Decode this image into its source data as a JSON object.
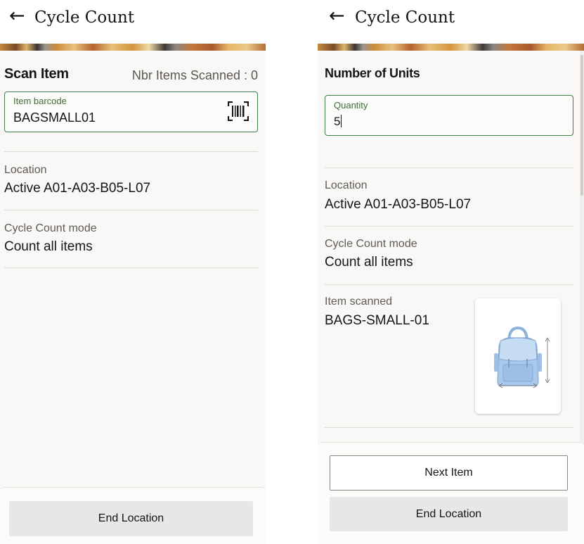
{
  "left_screen": {
    "app_bar": {
      "back_icon": "←",
      "title": "Cycle Count"
    },
    "scan_section": {
      "title": "Scan Item",
      "items_scanned_label": "Nbr Items Scanned : 0"
    },
    "barcode_field": {
      "label": "Item barcode",
      "value": "BAGSMALL01",
      "icon": "barcode-scanner-icon"
    },
    "location": {
      "label": "Location",
      "value": "Active A01-A03-B05-L07"
    },
    "cycle_count_mode": {
      "label": "Cycle Count mode",
      "value": "Count all items"
    },
    "buttons": {
      "end_location": "End Location"
    }
  },
  "right_screen": {
    "app_bar": {
      "back_icon": "←",
      "title": "Cycle Count"
    },
    "units_section": {
      "title": "Number of Units"
    },
    "quantity_field": {
      "label": "Quantity",
      "value": "5"
    },
    "location": {
      "label": "Location",
      "value": "Active A01-A03-B05-L07"
    },
    "cycle_count_mode": {
      "label": "Cycle Count mode",
      "value": "Count all items"
    },
    "item_scanned": {
      "label": "Item scanned",
      "value": "BAGS-SMALL-01",
      "image": "blue-backpack-product-image"
    },
    "buttons": {
      "next_item": "Next Item",
      "end_location": "End Location"
    }
  },
  "colors": {
    "field_border": "#3f7a4a",
    "field_label": "#3f6d38",
    "background": "#f9f8f6",
    "button_bg": "#e9e7e5"
  }
}
